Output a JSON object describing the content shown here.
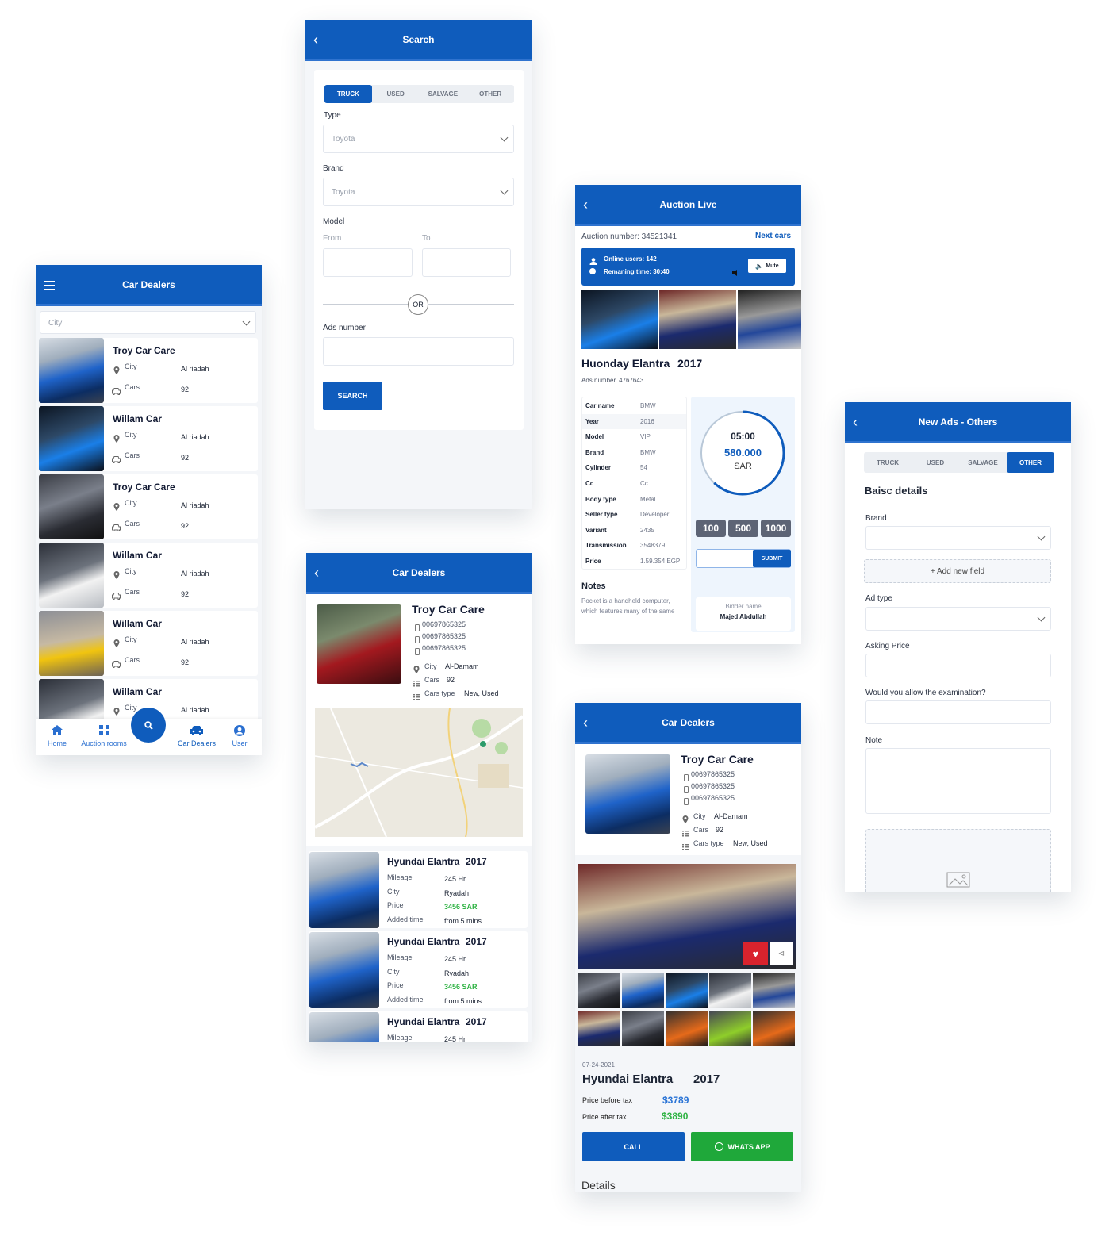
{
  "colors": {
    "primary": "#0f5cbc",
    "whatsapp": "#1fa83a",
    "price_green": "#2fb344",
    "price_blue": "#2a74d6"
  },
  "dealers_list": {
    "title": "Car Dealers",
    "menu_icon": "hamburger-icon",
    "city_placeholder": "City",
    "items": [
      {
        "name": "Troy Car Care",
        "city_label": "City",
        "city": "Al riadah",
        "cars_label": "Cars",
        "cars": "92",
        "image": "blue"
      },
      {
        "name": "Willam Car",
        "city_label": "City",
        "city": "Al riadah",
        "cars_label": "Cars",
        "cars": "92",
        "image": "night"
      },
      {
        "name": "Troy Car Care",
        "city_label": "City",
        "city": "Al riadah",
        "cars_label": "Cars",
        "cars": "92",
        "image": "dark"
      },
      {
        "name": "Willam Car",
        "city_label": "City",
        "city": "Al riadah",
        "cars_label": "Cars",
        "cars": "92",
        "image": "white"
      },
      {
        "name": "Willam Car",
        "city_label": "City",
        "city": "Al riadah",
        "cars_label": "Cars",
        "cars": "92",
        "image": "yellow"
      },
      {
        "name": "Willam Car",
        "city_label": "City",
        "city": "Al riadah",
        "cars_label": "Cars",
        "cars": "92",
        "image": "white"
      }
    ],
    "nav": [
      {
        "label": "Home",
        "icon": "home-icon"
      },
      {
        "label": "Auction rooms",
        "icon": "grid-icon"
      },
      {
        "label": "Car Dealers",
        "icon": "car-icon",
        "active": true
      },
      {
        "label": "User",
        "icon": "user-icon"
      }
    ],
    "fab_icon": "search-icon"
  },
  "search": {
    "title": "Search",
    "tabs": [
      {
        "label": "TRUCK",
        "active": true
      },
      {
        "label": "USED"
      },
      {
        "label": "SALVAGE"
      },
      {
        "label": "OTHER"
      }
    ],
    "type_label": "Type",
    "type_value": "Toyota",
    "brand_label": "Brand",
    "brand_value": "Toyota",
    "model_label": "Model",
    "from_label": "From",
    "to_label": "To",
    "or_label": "OR",
    "ads_number_label": "Ads number",
    "search_button": "SEARCH"
  },
  "dealer_map": {
    "title": "Car Dealers",
    "dealer": {
      "name": "Troy Car Care",
      "phones": [
        "00697865325",
        "00697865325",
        "00697865325"
      ],
      "city_label": "City",
      "city": "Al-Damam",
      "cars_label": "Cars",
      "cars": "92",
      "type_label": "Cars type",
      "type": "New, Used",
      "image": "red"
    },
    "listings": [
      {
        "title": "Hyundai Elantra",
        "year": "2017",
        "rows": [
          [
            "Mileage",
            "245 Hr"
          ],
          [
            "City",
            "Ryadah"
          ],
          [
            "Price",
            "3456 SAR"
          ],
          [
            "Added time",
            "from 5 mins"
          ]
        ]
      },
      {
        "title": "Hyundai Elantra",
        "year": "2017",
        "rows": [
          [
            "Mileage",
            "245 Hr"
          ],
          [
            "City",
            "Ryadah"
          ],
          [
            "Price",
            "3456 SAR"
          ],
          [
            "Added time",
            "from 5 mins"
          ]
        ]
      },
      {
        "title": "Hyundai Elantra",
        "year": "2017",
        "rows": [
          [
            "Mileage",
            "245 Hr"
          ]
        ]
      }
    ]
  },
  "auction": {
    "title": "Auction Live",
    "auction_number": "Auction number: 34521341",
    "next_cars": "Next cars",
    "online_users": "Online users: 142",
    "remaining_time": "Remaning time: 30:40",
    "mute": "Mute",
    "car_title": "Huonday Elantra",
    "car_year": "2017",
    "ads_number": "Ads number.  4767643",
    "specs": [
      [
        "Car name",
        "BMW"
      ],
      [
        "Year",
        "2016"
      ],
      [
        "Model",
        "VIP"
      ],
      [
        "Brand",
        "BMW"
      ],
      [
        "Cylinder",
        "54"
      ],
      [
        "Cc",
        "Cc"
      ],
      [
        "Body type",
        "Metal"
      ],
      [
        "Seller type",
        "Developer"
      ],
      [
        "Variant",
        "2435"
      ],
      [
        "Transmission",
        "3548379"
      ],
      [
        "Price",
        "1.59.354 EGP"
      ]
    ],
    "timer": "05:00",
    "current_bid": "580.000",
    "currency": "SAR",
    "timer_progress": 0.62,
    "increments": [
      "100",
      "500",
      "1000"
    ],
    "submit": "SUBMIT",
    "notes_title": "Notes",
    "notes": "Pocket is a handheld computer, which features many of the same",
    "bidder_label": "Bidder name",
    "bidder_name": "Majed Abdullah"
  },
  "dealer_detail": {
    "title": "Car Dealers",
    "dealer": {
      "name": "Troy Car Care",
      "phones": [
        "00697865325",
        "00697865325",
        "00697865325"
      ],
      "city_label": "City",
      "city": "Al-Damam",
      "cars_label": "Cars",
      "cars": "92",
      "type_label": "Cars type",
      "type": "New, Used",
      "image": "blue"
    },
    "thumbs": [
      "dark",
      "blue",
      "night",
      "white",
      "grey",
      "street",
      "dark",
      "orange",
      "lime",
      "orange"
    ],
    "date": "07-24-2021",
    "car_title": "Hyundai Elantra",
    "car_year": "2017",
    "price_before_label": "Price before tax",
    "price_before": "$3789",
    "price_after_label": "Price after tax",
    "price_after": "$3890",
    "call": "CALL",
    "whatsapp": "WHATS APP",
    "details": "Details"
  },
  "new_ads": {
    "title": "New Ads - Others",
    "tabs": [
      {
        "label": "TRUCK"
      },
      {
        "label": "USED"
      },
      {
        "label": "SALVAGE"
      },
      {
        "label": "OTHER",
        "active": true
      }
    ],
    "section": "Baisc details",
    "brand_label": "Brand",
    "add_field": "+ Add new field",
    "ad_type_label": "Ad type",
    "asking_price_label": "Asking Price",
    "examination_label": "Would you allow the examination?",
    "note_label": "Note"
  }
}
